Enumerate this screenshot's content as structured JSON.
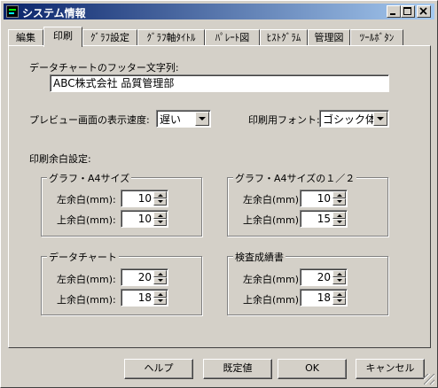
{
  "window": {
    "title": "システム情報"
  },
  "tabs": [
    {
      "label": "編集"
    },
    {
      "label": "印刷",
      "active": true
    },
    {
      "label": "ｸﾞﾗﾌ設定"
    },
    {
      "label": "ｸﾞﾗﾌ軸ﾀｲﾄﾙ"
    },
    {
      "label": "ﾊﾟﾚｰﾄ図"
    },
    {
      "label": "ﾋｽﾄｸﾞﾗﾑ"
    },
    {
      "label": "管理図"
    },
    {
      "label": "ﾂｰﾙﾎﾞﾀﾝ"
    }
  ],
  "print": {
    "footer_label": "データチャートのフッター文字列:",
    "footer_value": "ABC株式会社 品質管理部",
    "preview_speed_label": "プレビュー画面の表示速度:",
    "preview_speed_value": "遅い",
    "print_font_label": "印刷用フォント:",
    "print_font_value": "ゴシック体",
    "margin_settings_label": "印刷余白設定:",
    "groups": {
      "graph_a4": {
        "title": "グラフ・A4サイズ",
        "left_label": "左余白(mm):",
        "left": "10",
        "top_label": "上余白(mm):",
        "top": "10"
      },
      "graph_a4_half": {
        "title": "グラフ・A4サイズの１／２",
        "left_label": "左余白(mm):",
        "left": "10",
        "top_label": "上余白(mm):",
        "top": "15"
      },
      "data_chart": {
        "title": "データチャート",
        "left_label": "左余白(mm):",
        "left": "20",
        "top_label": "上余白(mm):",
        "top": "18"
      },
      "inspection_report": {
        "title": "検査成績書",
        "left_label": "左余白(mm):",
        "left": "20",
        "top_label": "上余白(mm):",
        "top": "18"
      }
    }
  },
  "buttons": {
    "help": "ヘルプ",
    "default": "既定値",
    "ok": "OK",
    "cancel": "キャンセル"
  },
  "colors": {
    "face": "#d4d0c8",
    "title_start": "#0a246a",
    "title_end": "#a6caf0"
  },
  "icons": [
    "app-icon",
    "minimize-icon",
    "maximize-icon",
    "close-icon",
    "dropdown-arrow-icon",
    "spin-up-icon",
    "spin-down-icon",
    "size-grip-icon"
  ]
}
